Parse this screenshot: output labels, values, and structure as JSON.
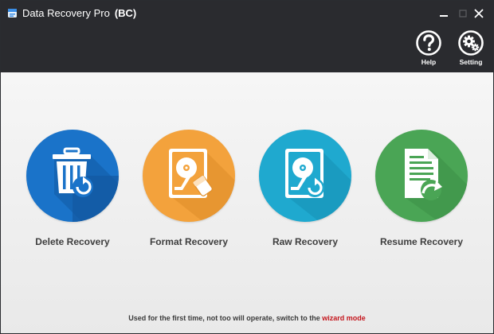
{
  "window": {
    "title": "Data Recovery Pro",
    "edition": "(BC)"
  },
  "toolbar": {
    "help_label": "Help",
    "setting_label": "Setting"
  },
  "modes": [
    {
      "label": "Delete Recovery",
      "icon": "trash-restore-icon",
      "color": "#1a73c9"
    },
    {
      "label": "Format Recovery",
      "icon": "hard-drive-erase-icon",
      "color": "#f3a23c"
    },
    {
      "label": "Raw Recovery",
      "icon": "hard-drive-restore-icon",
      "color": "#1fa9cf"
    },
    {
      "label": "Resume Recovery",
      "icon": "document-resume-icon",
      "color": "#4aa555"
    }
  ],
  "footer": {
    "text": "Used for the first time, not too will operate, switch to the",
    "link": "wizard mode"
  },
  "colors": {
    "titlebar": "#2a2b2f",
    "content_bg": "#ececec",
    "link": "#c4141b"
  }
}
